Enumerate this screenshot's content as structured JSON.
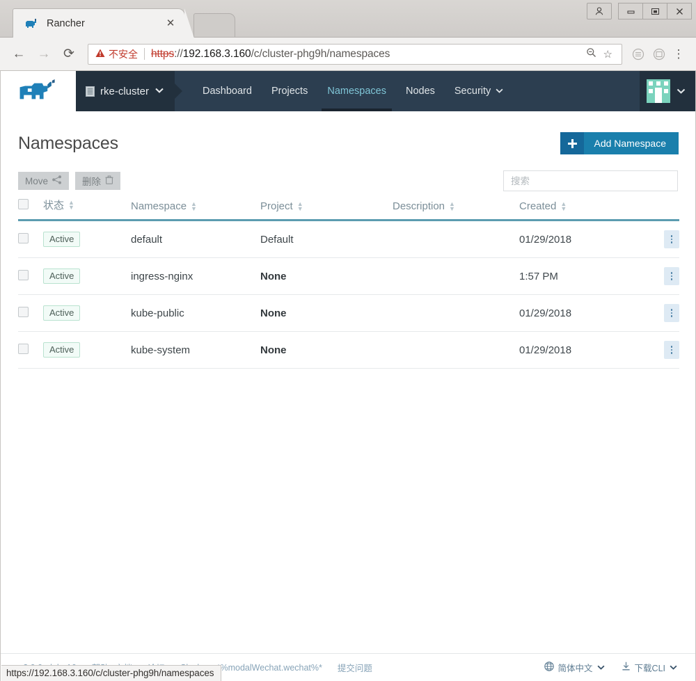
{
  "browser": {
    "tab_title": "Rancher",
    "tab_close": "✕",
    "favicon_name": "rancher-favicon",
    "back_icon": "←",
    "forward_icon": "→",
    "reload_icon": "⟳",
    "security_label": "不安全",
    "security_icon": "⚠",
    "url_scheme": "https",
    "url_sep": "://",
    "url_host": "192.168.3.160",
    "url_path": "/c/cluster-phg9h/namespaces",
    "zoom_icon": "⊖",
    "bookmark_icon": "☆",
    "menu_icon": "⋮",
    "window_user_icon": "☻",
    "window_minimize": "─",
    "window_maximize": "❐",
    "window_close": "✕",
    "status_url": "https://192.168.3.160/c/cluster-phg9h/namespaces"
  },
  "nav": {
    "logo_name": "rancher-logo",
    "cluster_name": "rke-cluster",
    "cluster_chevron": "❯",
    "links": [
      {
        "label": "Dashboard",
        "active": false,
        "caret": ""
      },
      {
        "label": "Projects",
        "active": false,
        "caret": ""
      },
      {
        "label": "Namespaces",
        "active": true,
        "caret": ""
      },
      {
        "label": "Nodes",
        "active": false,
        "caret": ""
      },
      {
        "label": "Security",
        "active": false,
        "caret": "❯"
      }
    ],
    "avatar_chevron": "❯"
  },
  "header": {
    "title": "Namespaces",
    "add_button_plus": "✛",
    "add_button_label": "Add Namespace"
  },
  "toolbar": {
    "move_label": "Move",
    "delete_label": "删除",
    "search_placeholder": "搜索",
    "search_value": ""
  },
  "table": {
    "columns": [
      {
        "label": "状态",
        "sortable": true
      },
      {
        "label": "Namespace",
        "sortable": true
      },
      {
        "label": "Project",
        "sortable": true
      },
      {
        "label": "Description",
        "sortable": true
      },
      {
        "label": "Created",
        "sortable": true
      }
    ],
    "rows": [
      {
        "state": "Active",
        "namespace": "default",
        "project": "Default",
        "project_bold": false,
        "description": "",
        "created": "01/29/2018"
      },
      {
        "state": "Active",
        "namespace": "ingress-nginx",
        "project": "None",
        "project_bold": true,
        "description": "",
        "created": "1:57 PM"
      },
      {
        "state": "Active",
        "namespace": "kube-public",
        "project": "None",
        "project_bold": true,
        "description": "",
        "created": "01/29/2018"
      },
      {
        "state": "Active",
        "namespace": "kube-system",
        "project": "None",
        "project_bold": true,
        "description": "",
        "created": "01/29/2018"
      }
    ]
  },
  "footer": {
    "links": [
      "v2.0.0-alpha16",
      "帮助&文档",
      "论坛",
      "Slack",
      "*%modalWechat.wechat%*",
      "提交问题"
    ],
    "language_label": "简体中文",
    "language_chevron": "❯",
    "cli_label": "下载CLI",
    "cli_chevron": "❯"
  },
  "colors": {
    "accent_blue": "#1a7fac",
    "nav_dark": "#2c3e50",
    "nav_darker": "#22303d",
    "active_tab_text": "#7fc5d6",
    "table_header_rule": "#5b9cb0",
    "badge_green": "#b9e2cf",
    "avatar_green": "#7bd3bd",
    "warn_red": "#c0392b"
  }
}
